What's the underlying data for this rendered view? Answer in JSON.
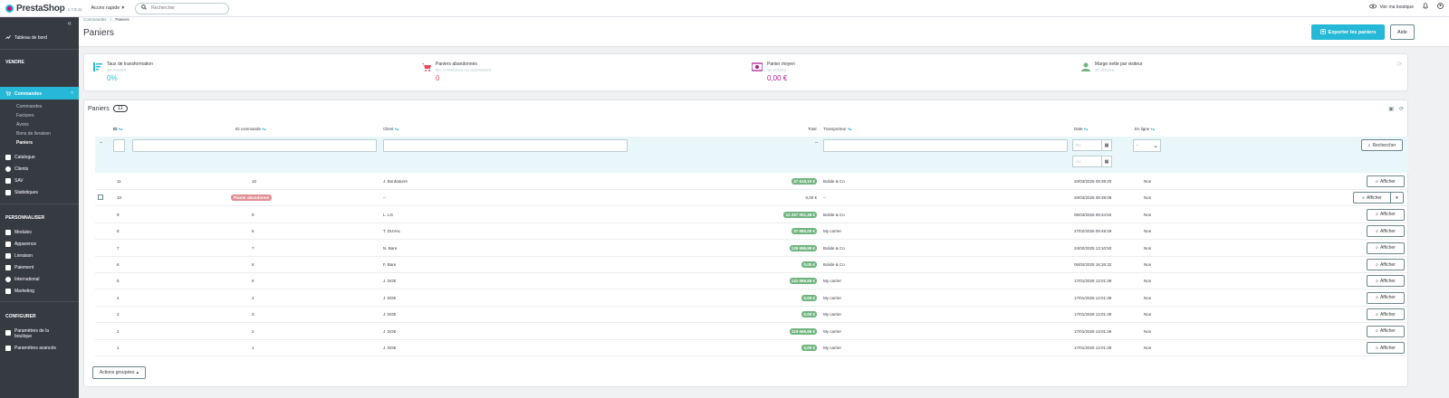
{
  "topbar": {
    "logo_text": "PrestaShop",
    "version": "1.7.8.11",
    "quick_access": "Accès rapide",
    "search_placeholder": "Rechercher",
    "view_shop": "Voir ma boutique"
  },
  "sidebar": {
    "dashboard": "Tableau de bord",
    "section_sell": "VENDRE",
    "orders": "Commandes",
    "orders_sub": [
      "Commandes",
      "Factures",
      "Avoirs",
      "Bons de livraison",
      "Paniers"
    ],
    "catalog": "Catalogue",
    "clients": "Clients",
    "sav": "SAV",
    "stats": "Statistiques",
    "section_customize": "PERSONNALISER",
    "modules": "Modules",
    "appearance": "Apparence",
    "shipping": "Livraison",
    "payment": "Paiement",
    "international": "International",
    "marketing": "Marketing",
    "section_configure": "CONFIGURER",
    "shop_params_1": "Paramètres de la",
    "shop_params_2": "boutique",
    "advanced_params": "Paramètres avancés"
  },
  "header": {
    "breadcrumb_1": "Commandes",
    "breadcrumb_sep": "/",
    "breadcrumb_2": "Paniers",
    "title": "Paniers",
    "export_button": "Exporter les paniers",
    "help_button": "Aide"
  },
  "kpis": [
    {
      "label": "Taux de transformation",
      "sub": "30 JOURS",
      "value": "0%",
      "color": "#25b9d7"
    },
    {
      "label": "Paniers abandonnés",
      "sub": "DU 17/05/2025 AU 18/05/2025",
      "value": "0",
      "color": "#e84a5f"
    },
    {
      "label": "Panier moyen",
      "sub": "30 JOURS",
      "value": "0,00 €",
      "color": "#ab1b93"
    },
    {
      "label": "Marge nette par visiteur",
      "sub": "30 JOURS",
      "value": "",
      "color": "#70b580"
    }
  ],
  "panel": {
    "title": "Paniers",
    "count": "11"
  },
  "columns": {
    "id": "ID",
    "order_id": "ID commande",
    "client": "Client",
    "total": "Total",
    "carrier": "Transporteur",
    "date": "Date",
    "online": "En ligne"
  },
  "filters": {
    "total_dash": "--",
    "date_from": "Du",
    "date_to": "Au",
    "online_select": "-",
    "search_button": "Rechercher",
    "row_dash": "--"
  },
  "rows": [
    {
      "id": "11",
      "order": "10",
      "client": "J. Bonbaturre",
      "total": "37 618,10 €",
      "carrier": "Bolide & Co",
      "date": "20/03/2025 09:39:20",
      "online": "Non",
      "pill": true
    },
    {
      "id": "10",
      "order": "Panier abandonné",
      "client": "--",
      "total": "0,00 €",
      "carrier": "",
      "date": "20/03/2025 09:39:09",
      "online": "Non",
      "pill": false
    },
    {
      "id": "9",
      "order": "9",
      "client": "L. LG",
      "total": "12 297 001,38 €",
      "carrier": "Bolide & Co",
      "date": "06/03/2025 09:34:50",
      "online": "Non",
      "pill": true
    },
    {
      "id": "8",
      "order": "8",
      "client": "T. DUVAL",
      "total": "37 990,00 €",
      "carrier": "My carrier",
      "date": "27/02/2025 09:49:29",
      "online": "Non",
      "pill": true
    },
    {
      "id": "7",
      "order": "7",
      "client": "N. Bare",
      "total": "139 999,99 €",
      "carrier": "Bolide & Co",
      "date": "24/02/2025 13:10:50",
      "online": "Non",
      "pill": true
    },
    {
      "id": "6",
      "order": "6",
      "client": "F. Bare",
      "total": "0,00 €",
      "carrier": "Bolide & Co",
      "date": "06/02/2025 16:26:32",
      "online": "Non",
      "pill": true
    },
    {
      "id": "5",
      "order": "5",
      "client": "J. DOE",
      "total": "141 666,66 €",
      "carrier": "My carrier",
      "date": "17/01/2025 13:01:39",
      "online": "Non",
      "pill": true
    },
    {
      "id": "4",
      "order": "4",
      "client": "J. DOE",
      "total": "0,00 €",
      "carrier": "My carrier",
      "date": "17/01/2025 13:01:39",
      "online": "Non",
      "pill": true
    },
    {
      "id": "3",
      "order": "3",
      "client": "J. DOE",
      "total": "0,00 €",
      "carrier": "My carrier",
      "date": "17/01/2025 13:01:39",
      "online": "Non",
      "pill": true
    },
    {
      "id": "2",
      "order": "2",
      "client": "J. DOE",
      "total": "119 666,66 €",
      "carrier": "My carrier",
      "date": "17/01/2025 13:01:39",
      "online": "Non",
      "pill": true
    },
    {
      "id": "1",
      "order": "1",
      "client": "J. DOE",
      "total": "0,00 €",
      "carrier": "My carrier",
      "date": "17/01/2025 13:01:39",
      "online": "Non",
      "pill": true
    }
  ],
  "row_action": "Afficher",
  "bulk_actions": "Actions groupées"
}
